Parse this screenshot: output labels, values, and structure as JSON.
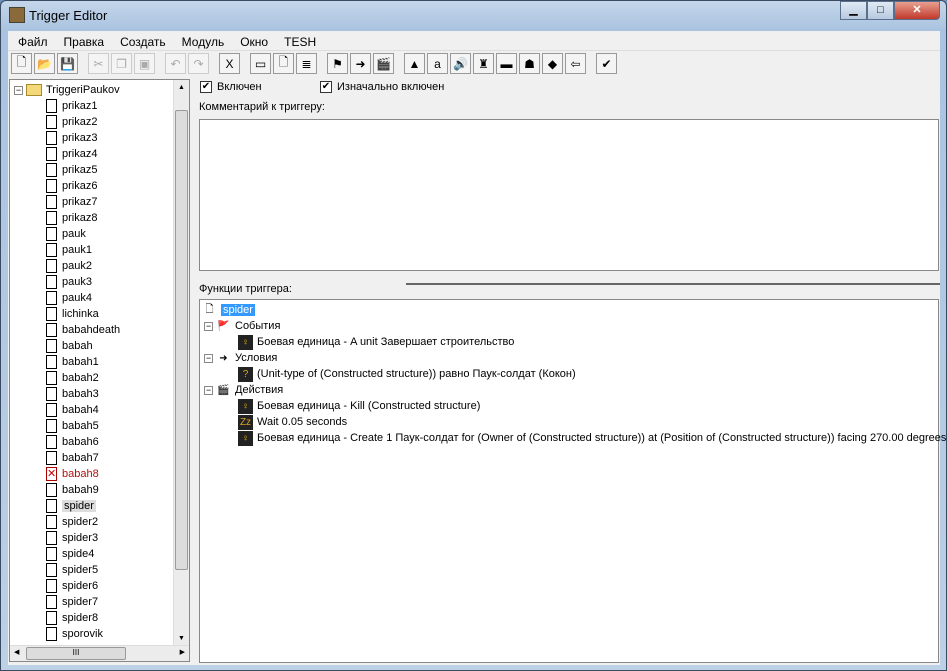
{
  "window": {
    "title": "Trigger Editor"
  },
  "menu": [
    "Файл",
    "Правка",
    "Создать",
    "Модуль",
    "Окно",
    "TESH"
  ],
  "toolbar": [
    {
      "icon": "new-icon",
      "g": "🗋"
    },
    {
      "icon": "open-icon",
      "g": "📂"
    },
    {
      "icon": "save-icon",
      "g": "💾"
    },
    {
      "sep": true
    },
    {
      "icon": "cut-icon",
      "g": "✂",
      "dis": true
    },
    {
      "icon": "copy-icon",
      "g": "❐",
      "dis": true
    },
    {
      "icon": "paste-icon",
      "g": "▣",
      "dis": true
    },
    {
      "sep": true
    },
    {
      "icon": "undo-icon",
      "g": "↶",
      "dis": true
    },
    {
      "icon": "redo-icon",
      "g": "↷",
      "dis": true
    },
    {
      "sep": true
    },
    {
      "icon": "close-x-icon",
      "g": "X"
    },
    {
      "sep": true
    },
    {
      "icon": "new-category-icon",
      "g": "▭"
    },
    {
      "icon": "new-trigger-icon",
      "g": "🗋"
    },
    {
      "icon": "new-comment-icon",
      "g": "≣"
    },
    {
      "sep": true
    },
    {
      "icon": "new-event-icon",
      "g": "⚑"
    },
    {
      "icon": "new-condition-icon",
      "g": "➜"
    },
    {
      "icon": "new-action-icon",
      "g": "🎬"
    },
    {
      "sep": true
    },
    {
      "icon": "terrain-editor-icon",
      "g": "▲"
    },
    {
      "icon": "trigger-editor-icon",
      "g": "a"
    },
    {
      "icon": "sound-editor-icon",
      "g": "🔊"
    },
    {
      "icon": "object-editor-icon",
      "g": "♜"
    },
    {
      "icon": "campaign-editor-icon",
      "g": "▬"
    },
    {
      "icon": "ai-editor-icon",
      "g": "☗"
    },
    {
      "icon": "object-manager-icon",
      "g": "◆"
    },
    {
      "icon": "import-manager-icon",
      "g": "⇦"
    },
    {
      "sep": true
    },
    {
      "icon": "test-map-icon",
      "g": "✔"
    }
  ],
  "tree": {
    "root": "TriggeriPaukov",
    "items": [
      {
        "label": "prikaz1"
      },
      {
        "label": "prikaz2"
      },
      {
        "label": "prikaz3"
      },
      {
        "label": "prikaz4"
      },
      {
        "label": "prikaz5"
      },
      {
        "label": "prikaz6"
      },
      {
        "label": "prikaz7"
      },
      {
        "label": "prikaz8"
      },
      {
        "label": "pauk"
      },
      {
        "label": "pauk1"
      },
      {
        "label": "pauk2"
      },
      {
        "label": "pauk3"
      },
      {
        "label": "pauk4"
      },
      {
        "label": "lichinka"
      },
      {
        "label": "babahdeath"
      },
      {
        "label": "babah"
      },
      {
        "label": "babah1"
      },
      {
        "label": "babah2"
      },
      {
        "label": "babah3"
      },
      {
        "label": "babah4"
      },
      {
        "label": "babah5"
      },
      {
        "label": "babah6"
      },
      {
        "label": "babah7"
      },
      {
        "label": "babah8",
        "disabled": true
      },
      {
        "label": "babah9"
      },
      {
        "label": "spider",
        "selected": true
      },
      {
        "label": "spider2"
      },
      {
        "label": "spider3"
      },
      {
        "label": "spide4"
      },
      {
        "label": "spider5"
      },
      {
        "label": "spider6"
      },
      {
        "label": "spider7"
      },
      {
        "label": "spider8"
      },
      {
        "label": "sporovik"
      }
    ],
    "hscroll_grip": "III"
  },
  "trigger": {
    "enabled_label": "Включен",
    "enabled": true,
    "initially_on_label": "Изначально включен",
    "initially_on": true,
    "comment_label": "Комментарий к триггеру:",
    "comment": "",
    "functions_label": "Функции триггера:",
    "name": "spider",
    "events_label": "События",
    "events": [
      "Боевая единица - A unit Завершает строительство"
    ],
    "conditions_label": "Условия",
    "conditions": [
      "(Unit-type of (Constructed structure)) равно Паук-солдат (Кокон)"
    ],
    "actions_label": "Действия",
    "actions": [
      {
        "icon": "unit-icon",
        "text": "Боевая единица - Kill (Constructed structure)"
      },
      {
        "icon": "wait-icon",
        "text": "Wait 0.05 seconds"
      },
      {
        "icon": "unit-icon",
        "text": "Боевая единица - Create 1 Паук-солдат for (Owner of (Constructed structure)) at (Position of (Constructed structure)) facing 270.00 degrees"
      }
    ]
  },
  "colors": {
    "disabled": "#b01010",
    "selection": "#3399ff"
  }
}
